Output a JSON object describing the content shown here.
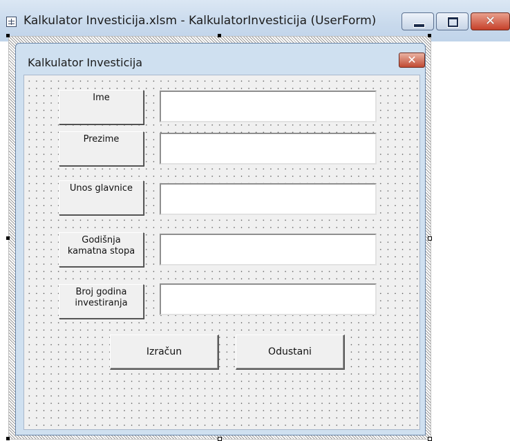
{
  "window": {
    "title": "Kalkulator Investicija.xlsm - KalkulatorInvesticija (UserForm)",
    "icon": "userform-icon",
    "buttons": {
      "minimize": "minimize-icon",
      "maximize": "maximize-icon",
      "close": "✕"
    }
  },
  "form": {
    "title": "Kalkulator Investicija",
    "close": "✕"
  },
  "fields": [
    {
      "label_lines": [
        "Ime"
      ],
      "value": ""
    },
    {
      "label_lines": [
        "Prezime"
      ],
      "value": ""
    },
    {
      "label_lines": [
        "Unos glavnice"
      ],
      "value": ""
    },
    {
      "label_lines": [
        "Godišnja",
        "kamatna stopa"
      ],
      "value": ""
    },
    {
      "label_lines": [
        "Broj godina",
        "investiranja"
      ],
      "value": ""
    }
  ],
  "buttons": {
    "calculate": "Izračun",
    "cancel": "Odustani"
  },
  "colors": {
    "form_border": "#6a86a8",
    "close_red": "#c14a33",
    "client_bg": "#f0f0f0"
  }
}
